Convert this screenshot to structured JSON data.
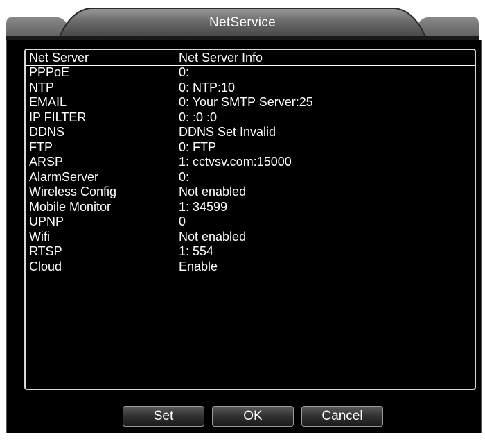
{
  "window": {
    "title": "NetService"
  },
  "table": {
    "headers": {
      "name": "Net Server",
      "info": "Net Server Info"
    },
    "rows": [
      {
        "name": "PPPoE",
        "info": "0:"
      },
      {
        "name": "NTP",
        "info": "0: NTP:10"
      },
      {
        "name": "EMAIL",
        "info": "0: Your SMTP Server:25"
      },
      {
        "name": "IP FILTER",
        "info": "0: :0 :0"
      },
      {
        "name": "DDNS",
        "info": "DDNS Set Invalid"
      },
      {
        "name": "FTP",
        "info": "0: FTP"
      },
      {
        "name": "ARSP",
        "info": "1: cctvsv.com:15000"
      },
      {
        "name": "AlarmServer",
        "info": "0:"
      },
      {
        "name": "Wireless Config",
        "info": "Not enabled"
      },
      {
        "name": "Mobile Monitor",
        "info": "1: 34599"
      },
      {
        "name": "UPNP",
        "info": "0"
      },
      {
        "name": "Wifi",
        "info": "Not enabled"
      },
      {
        "name": "RTSP",
        "info": "1: 554"
      },
      {
        "name": "Cloud",
        "info": "Enable"
      }
    ]
  },
  "buttons": {
    "set": "Set",
    "ok": "OK",
    "cancel": "Cancel"
  },
  "colors": {
    "background": "#000000",
    "text": "#ffffff",
    "frame": "#ffffff"
  }
}
